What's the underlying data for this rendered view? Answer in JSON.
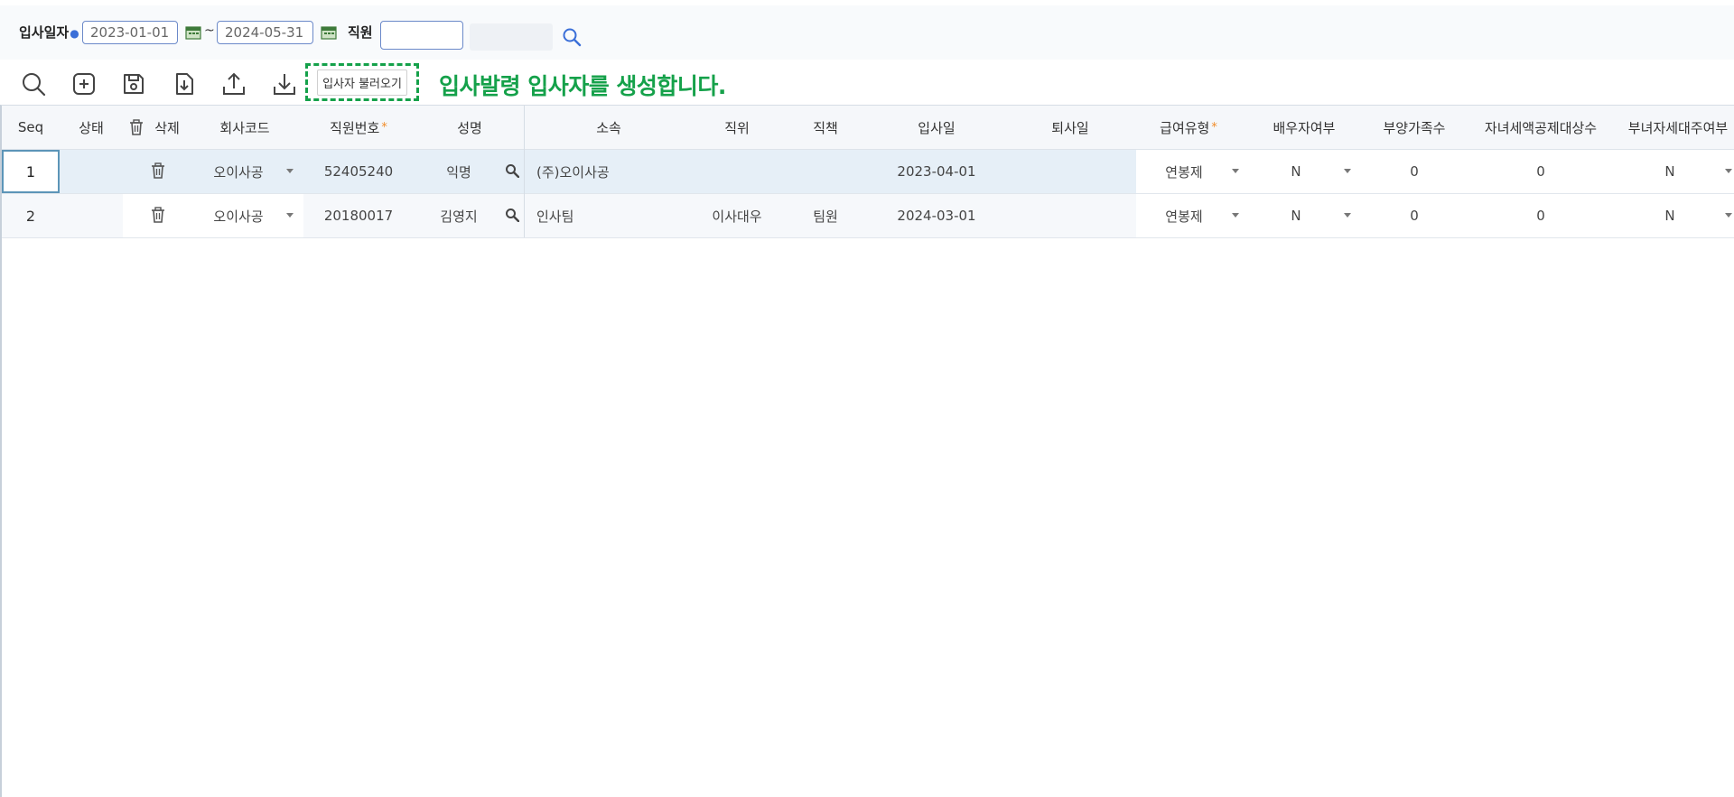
{
  "filter": {
    "join_date_label": "입사일자",
    "date_from": "2023-01-01",
    "date_to": "2024-05-31",
    "range_sep": "~",
    "employee_label": "직원",
    "employee_value": ""
  },
  "toolbar": {
    "icons": [
      "search-icon",
      "add-icon",
      "save-icon",
      "import-file-icon",
      "upload-icon",
      "download-icon"
    ],
    "load_hires_label": "입사자 불러오기",
    "hint": "입사발령 입사자를 생성합니다."
  },
  "grid": {
    "headers": {
      "seq": "Seq",
      "status": "상태",
      "delete": "삭제",
      "company_code": "회사코드",
      "emp_no": "직원번호",
      "name": "성명",
      "dept": "소속",
      "position": "직위",
      "duty": "직책",
      "join_date": "입사일",
      "leave_date": "퇴사일",
      "pay_type": "급여유형",
      "spouse": "배우자여부",
      "dependents": "부양가족수",
      "child_credit": "자녀세액공제대상수",
      "single_parent": "부녀자세대주여부"
    },
    "required_mark": "*",
    "rows": [
      {
        "seq": "1",
        "status": "",
        "company_code": "오이사공",
        "emp_no": "52405240",
        "name": "익명",
        "dept": "(주)오이사공",
        "position": "",
        "duty": "",
        "join_date": "2023-04-01",
        "leave_date": "",
        "pay_type": "연봉제",
        "spouse": "N",
        "dependents": "0",
        "child_credit": "0",
        "single_parent": "N"
      },
      {
        "seq": "2",
        "status": "",
        "company_code": "오이사공",
        "emp_no": "20180017",
        "name": "김영지",
        "dept": "인사팀",
        "position": "이사대우",
        "duty": "팀원",
        "join_date": "2024-03-01",
        "leave_date": "",
        "pay_type": "연봉제",
        "spouse": "N",
        "dependents": "0",
        "child_credit": "0",
        "single_parent": "N"
      }
    ]
  },
  "colors": {
    "accent_green": "#15a14a",
    "selected_row": "#e6eff7",
    "required_star": "#f28c28",
    "input_border": "#6b89c9"
  }
}
